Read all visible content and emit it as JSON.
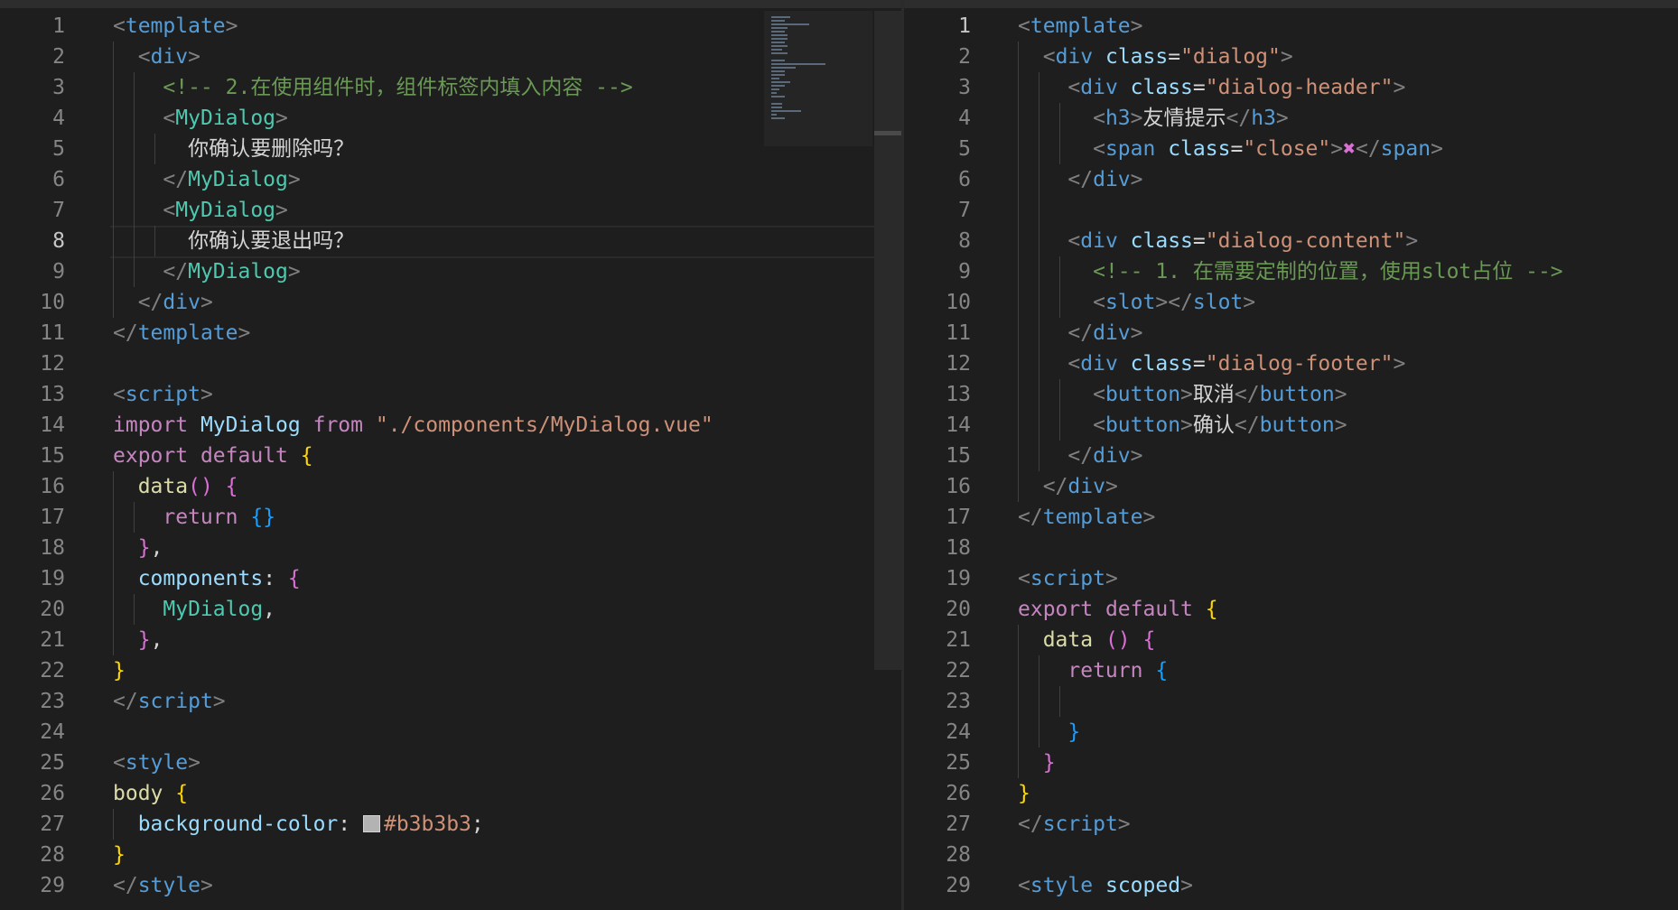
{
  "left_editor": {
    "lines": [
      {
        "num": "1",
        "tokens": [
          {
            "t": "<",
            "c": "tg"
          },
          {
            "t": "template",
            "c": "tn"
          },
          {
            "t": ">",
            "c": "tg"
          }
        ]
      },
      {
        "num": "2",
        "tokens": [
          {
            "t": "  "
          },
          {
            "t": "<",
            "c": "tg"
          },
          {
            "t": "div",
            "c": "tn"
          },
          {
            "t": ">",
            "c": "tg"
          }
        ]
      },
      {
        "num": "3",
        "tokens": [
          {
            "t": "    "
          },
          {
            "t": "<!-- 2.在使用组件时，组件标签内填入内容 -->",
            "c": "cm"
          }
        ]
      },
      {
        "num": "4",
        "tokens": [
          {
            "t": "    "
          },
          {
            "t": "<",
            "c": "tg"
          },
          {
            "t": "MyDialog",
            "c": "cn"
          },
          {
            "t": ">",
            "c": "tg"
          }
        ]
      },
      {
        "num": "5",
        "tokens": [
          {
            "t": "      "
          },
          {
            "t": "你确认要删除吗？",
            "c": "tx"
          }
        ]
      },
      {
        "num": "6",
        "tokens": [
          {
            "t": "    "
          },
          {
            "t": "</",
            "c": "tg"
          },
          {
            "t": "MyDialog",
            "c": "cn"
          },
          {
            "t": ">",
            "c": "tg"
          }
        ]
      },
      {
        "num": "7",
        "tokens": [
          {
            "t": "    "
          },
          {
            "t": "<",
            "c": "tg"
          },
          {
            "t": "MyDialog",
            "c": "cn"
          },
          {
            "t": ">",
            "c": "tg"
          }
        ]
      },
      {
        "num": "8",
        "tokens": [
          {
            "t": "      "
          },
          {
            "t": "你确认要退出吗？",
            "c": "tx"
          }
        ]
      },
      {
        "num": "9",
        "tokens": [
          {
            "t": "    "
          },
          {
            "t": "</",
            "c": "tg"
          },
          {
            "t": "MyDialog",
            "c": "cn"
          },
          {
            "t": ">",
            "c": "tg"
          }
        ]
      },
      {
        "num": "10",
        "tokens": [
          {
            "t": "  "
          },
          {
            "t": "</",
            "c": "tg"
          },
          {
            "t": "div",
            "c": "tn"
          },
          {
            "t": ">",
            "c": "tg"
          }
        ]
      },
      {
        "num": "11",
        "tokens": [
          {
            "t": "</",
            "c": "tg"
          },
          {
            "t": "template",
            "c": "tn"
          },
          {
            "t": ">",
            "c": "tg"
          }
        ]
      },
      {
        "num": "12",
        "tokens": []
      },
      {
        "num": "13",
        "tokens": [
          {
            "t": "<",
            "c": "tg"
          },
          {
            "t": "script",
            "c": "tn"
          },
          {
            "t": ">",
            "c": "tg"
          }
        ]
      },
      {
        "num": "14",
        "tokens": [
          {
            "t": "import",
            "c": "kw"
          },
          {
            "t": " "
          },
          {
            "t": "MyDialog",
            "c": "pr"
          },
          {
            "t": " "
          },
          {
            "t": "from",
            "c": "kw"
          },
          {
            "t": " "
          },
          {
            "t": "\"./components/MyDialog.vue\"",
            "c": "sv"
          }
        ]
      },
      {
        "num": "15",
        "tokens": [
          {
            "t": "export",
            "c": "kw"
          },
          {
            "t": " "
          },
          {
            "t": "default",
            "c": "kw"
          },
          {
            "t": " "
          },
          {
            "t": "{",
            "c": "b1"
          }
        ]
      },
      {
        "num": "16",
        "tokens": [
          {
            "t": "  "
          },
          {
            "t": "data",
            "c": "fn"
          },
          {
            "t": "()",
            "c": "b2"
          },
          {
            "t": " "
          },
          {
            "t": "{",
            "c": "b2"
          }
        ]
      },
      {
        "num": "17",
        "tokens": [
          {
            "t": "    "
          },
          {
            "t": "return",
            "c": "kw"
          },
          {
            "t": " "
          },
          {
            "t": "{}",
            "c": "b3"
          }
        ]
      },
      {
        "num": "18",
        "tokens": [
          {
            "t": "  "
          },
          {
            "t": "}",
            "c": "b2"
          },
          {
            "t": ",",
            "c": "tx"
          }
        ]
      },
      {
        "num": "19",
        "tokens": [
          {
            "t": "  "
          },
          {
            "t": "components",
            "c": "pr"
          },
          {
            "t": ": ",
            "c": "tx"
          },
          {
            "t": "{",
            "c": "b2"
          }
        ]
      },
      {
        "num": "20",
        "tokens": [
          {
            "t": "    "
          },
          {
            "t": "MyDialog",
            "c": "cn"
          },
          {
            "t": ",",
            "c": "tx"
          }
        ]
      },
      {
        "num": "21",
        "tokens": [
          {
            "t": "  "
          },
          {
            "t": "}",
            "c": "b2"
          },
          {
            "t": ",",
            "c": "tx"
          }
        ]
      },
      {
        "num": "22",
        "tokens": [
          {
            "t": "}",
            "c": "b1"
          }
        ]
      },
      {
        "num": "23",
        "tokens": [
          {
            "t": "</",
            "c": "tg"
          },
          {
            "t": "script",
            "c": "tn"
          },
          {
            "t": ">",
            "c": "tg"
          }
        ]
      },
      {
        "num": "24",
        "tokens": []
      },
      {
        "num": "25",
        "tokens": [
          {
            "t": "<",
            "c": "tg"
          },
          {
            "t": "style",
            "c": "tn"
          },
          {
            "t": ">",
            "c": "tg"
          }
        ]
      },
      {
        "num": "26",
        "tokens": [
          {
            "t": "body",
            "c": "fn"
          },
          {
            "t": " "
          },
          {
            "t": "{",
            "c": "b1"
          }
        ]
      },
      {
        "num": "27",
        "tokens": [
          {
            "t": "  "
          },
          {
            "t": "background-color",
            "c": "pr"
          },
          {
            "t": ": ",
            "c": "tx"
          },
          {
            "t": "",
            "c": "swatch"
          },
          {
            "t": "#b3b3b3",
            "c": "sv"
          },
          {
            "t": ";",
            "c": "tx"
          }
        ]
      },
      {
        "num": "28",
        "tokens": [
          {
            "t": "}",
            "c": "b1"
          }
        ]
      },
      {
        "num": "29",
        "tokens": [
          {
            "t": "</",
            "c": "tg"
          },
          {
            "t": "style",
            "c": "tn"
          },
          {
            "t": ">",
            "c": "tg"
          }
        ]
      }
    ],
    "active_line": "8",
    "color_swatch": "#b3b3b3"
  },
  "right_editor": {
    "lines": [
      {
        "num": "1",
        "tokens": [
          {
            "t": "<",
            "c": "tg"
          },
          {
            "t": "template",
            "c": "tn"
          },
          {
            "t": ">",
            "c": "tg"
          }
        ]
      },
      {
        "num": "2",
        "tokens": [
          {
            "t": "  "
          },
          {
            "t": "<",
            "c": "tg"
          },
          {
            "t": "div",
            "c": "tn"
          },
          {
            "t": " "
          },
          {
            "t": "class",
            "c": "at"
          },
          {
            "t": "=",
            "c": "tx"
          },
          {
            "t": "\"dialog\"",
            "c": "sv"
          },
          {
            "t": ">",
            "c": "tg"
          }
        ]
      },
      {
        "num": "3",
        "tokens": [
          {
            "t": "    "
          },
          {
            "t": "<",
            "c": "tg"
          },
          {
            "t": "div",
            "c": "tn"
          },
          {
            "t": " "
          },
          {
            "t": "class",
            "c": "at"
          },
          {
            "t": "=",
            "c": "tx"
          },
          {
            "t": "\"dialog-header\"",
            "c": "sv"
          },
          {
            "t": ">",
            "c": "tg"
          }
        ]
      },
      {
        "num": "4",
        "tokens": [
          {
            "t": "      "
          },
          {
            "t": "<",
            "c": "tg"
          },
          {
            "t": "h3",
            "c": "tn"
          },
          {
            "t": ">",
            "c": "tg"
          },
          {
            "t": "友情提示",
            "c": "tx"
          },
          {
            "t": "</",
            "c": "tg"
          },
          {
            "t": "h3",
            "c": "tn"
          },
          {
            "t": ">",
            "c": "tg"
          }
        ]
      },
      {
        "num": "5",
        "tokens": [
          {
            "t": "      "
          },
          {
            "t": "<",
            "c": "tg"
          },
          {
            "t": "span",
            "c": "tn"
          },
          {
            "t": " "
          },
          {
            "t": "class",
            "c": "at"
          },
          {
            "t": "=",
            "c": "tx"
          },
          {
            "t": "\"close\"",
            "c": "sv"
          },
          {
            "t": ">",
            "c": "tg"
          },
          {
            "t": "✖",
            "c": "b2"
          },
          {
            "t": "</",
            "c": "tg"
          },
          {
            "t": "span",
            "c": "tn"
          },
          {
            "t": ">",
            "c": "tg"
          }
        ]
      },
      {
        "num": "6",
        "tokens": [
          {
            "t": "    "
          },
          {
            "t": "</",
            "c": "tg"
          },
          {
            "t": "div",
            "c": "tn"
          },
          {
            "t": ">",
            "c": "tg"
          }
        ]
      },
      {
        "num": "7",
        "tokens": []
      },
      {
        "num": "8",
        "tokens": [
          {
            "t": "    "
          },
          {
            "t": "<",
            "c": "tg"
          },
          {
            "t": "div",
            "c": "tn"
          },
          {
            "t": " "
          },
          {
            "t": "class",
            "c": "at"
          },
          {
            "t": "=",
            "c": "tx"
          },
          {
            "t": "\"dialog-content\"",
            "c": "sv"
          },
          {
            "t": ">",
            "c": "tg"
          }
        ]
      },
      {
        "num": "9",
        "tokens": [
          {
            "t": "      "
          },
          {
            "t": "<!-- 1. 在需要定制的位置，使用slot占位 -->",
            "c": "cm"
          }
        ]
      },
      {
        "num": "10",
        "tokens": [
          {
            "t": "      "
          },
          {
            "t": "<",
            "c": "tg"
          },
          {
            "t": "slot",
            "c": "tn"
          },
          {
            "t": "></",
            "c": "tg"
          },
          {
            "t": "slot",
            "c": "tn"
          },
          {
            "t": ">",
            "c": "tg"
          }
        ]
      },
      {
        "num": "11",
        "tokens": [
          {
            "t": "    "
          },
          {
            "t": "</",
            "c": "tg"
          },
          {
            "t": "div",
            "c": "tn"
          },
          {
            "t": ">",
            "c": "tg"
          }
        ]
      },
      {
        "num": "12",
        "tokens": [
          {
            "t": "    "
          },
          {
            "t": "<",
            "c": "tg"
          },
          {
            "t": "div",
            "c": "tn"
          },
          {
            "t": " "
          },
          {
            "t": "class",
            "c": "at"
          },
          {
            "t": "=",
            "c": "tx"
          },
          {
            "t": "\"dialog-footer\"",
            "c": "sv"
          },
          {
            "t": ">",
            "c": "tg"
          }
        ]
      },
      {
        "num": "13",
        "tokens": [
          {
            "t": "      "
          },
          {
            "t": "<",
            "c": "tg"
          },
          {
            "t": "button",
            "c": "tn"
          },
          {
            "t": ">",
            "c": "tg"
          },
          {
            "t": "取消",
            "c": "tx"
          },
          {
            "t": "</",
            "c": "tg"
          },
          {
            "t": "button",
            "c": "tn"
          },
          {
            "t": ">",
            "c": "tg"
          }
        ]
      },
      {
        "num": "14",
        "tokens": [
          {
            "t": "      "
          },
          {
            "t": "<",
            "c": "tg"
          },
          {
            "t": "button",
            "c": "tn"
          },
          {
            "t": ">",
            "c": "tg"
          },
          {
            "t": "确认",
            "c": "tx"
          },
          {
            "t": "</",
            "c": "tg"
          },
          {
            "t": "button",
            "c": "tn"
          },
          {
            "t": ">",
            "c": "tg"
          }
        ]
      },
      {
        "num": "15",
        "tokens": [
          {
            "t": "    "
          },
          {
            "t": "</",
            "c": "tg"
          },
          {
            "t": "div",
            "c": "tn"
          },
          {
            "t": ">",
            "c": "tg"
          }
        ]
      },
      {
        "num": "16",
        "tokens": [
          {
            "t": "  "
          },
          {
            "t": "</",
            "c": "tg"
          },
          {
            "t": "div",
            "c": "tn"
          },
          {
            "t": ">",
            "c": "tg"
          }
        ]
      },
      {
        "num": "17",
        "tokens": [
          {
            "t": "</",
            "c": "tg"
          },
          {
            "t": "template",
            "c": "tn"
          },
          {
            "t": ">",
            "c": "tg"
          }
        ]
      },
      {
        "num": "18",
        "tokens": []
      },
      {
        "num": "19",
        "tokens": [
          {
            "t": "<",
            "c": "tg"
          },
          {
            "t": "script",
            "c": "tn"
          },
          {
            "t": ">",
            "c": "tg"
          }
        ]
      },
      {
        "num": "20",
        "tokens": [
          {
            "t": "export",
            "c": "kw"
          },
          {
            "t": " "
          },
          {
            "t": "default",
            "c": "kw"
          },
          {
            "t": " "
          },
          {
            "t": "{",
            "c": "b1"
          }
        ]
      },
      {
        "num": "21",
        "tokens": [
          {
            "t": "  "
          },
          {
            "t": "data",
            "c": "fn"
          },
          {
            "t": " "
          },
          {
            "t": "()",
            "c": "b2"
          },
          {
            "t": " "
          },
          {
            "t": "{",
            "c": "b2"
          }
        ]
      },
      {
        "num": "22",
        "tokens": [
          {
            "t": "    "
          },
          {
            "t": "return",
            "c": "kw"
          },
          {
            "t": " "
          },
          {
            "t": "{",
            "c": "b3"
          }
        ]
      },
      {
        "num": "23",
        "tokens": []
      },
      {
        "num": "24",
        "tokens": [
          {
            "t": "    "
          },
          {
            "t": "}",
            "c": "b3"
          }
        ]
      },
      {
        "num": "25",
        "tokens": [
          {
            "t": "  "
          },
          {
            "t": "}",
            "c": "b2"
          }
        ]
      },
      {
        "num": "26",
        "tokens": [
          {
            "t": "}",
            "c": "b1"
          }
        ]
      },
      {
        "num": "27",
        "tokens": [
          {
            "t": "</",
            "c": "tg"
          },
          {
            "t": "script",
            "c": "tn"
          },
          {
            "t": ">",
            "c": "tg"
          }
        ]
      },
      {
        "num": "28",
        "tokens": []
      },
      {
        "num": "29",
        "tokens": [
          {
            "t": "<",
            "c": "tg"
          },
          {
            "t": "style",
            "c": "tn"
          },
          {
            "t": " "
          },
          {
            "t": "scoped",
            "c": "at"
          },
          {
            "t": ">",
            "c": "tg"
          }
        ]
      }
    ],
    "active_line": "1"
  },
  "colors": {
    "background": "#1e1e1e",
    "tag_bracket": "#808080",
    "tag_name": "#569cd6",
    "component_name": "#4ec9b0",
    "attribute": "#9cdcfe",
    "string": "#ce9178",
    "comment": "#6a9955",
    "keyword": "#c586c0",
    "function": "#dcdcaa",
    "bracket_level1": "#ffd700",
    "bracket_level2": "#da70d6",
    "bracket_level3": "#179fff"
  },
  "icons": {
    "minimap": "minimap-preview",
    "swatch": "color-swatch-icon"
  }
}
